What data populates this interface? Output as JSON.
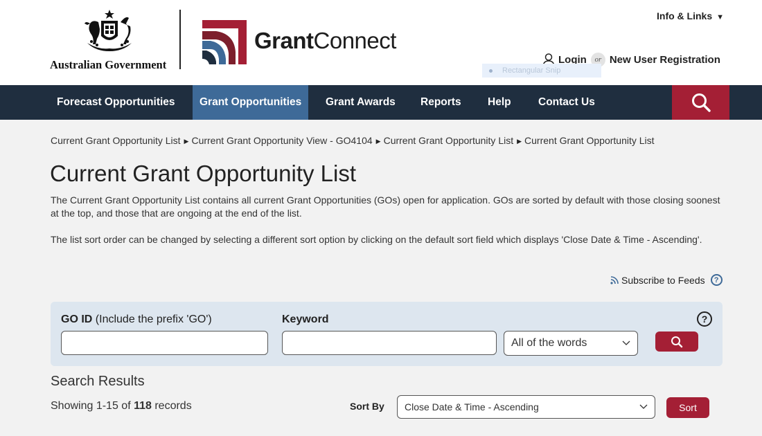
{
  "header": {
    "govt_logo_text": "Australian Government",
    "brand_bold": "Grant",
    "brand_light": "Connect",
    "info_links": "Info & Links",
    "login": "Login",
    "or": "or",
    "register": "New User Registration",
    "snip_overlay": "Rectangular Snip"
  },
  "nav": {
    "items": [
      {
        "label": "Forecast Opportunities"
      },
      {
        "label": "Grant Opportunities"
      },
      {
        "label": "Grant Awards"
      },
      {
        "label": "Reports"
      },
      {
        "label": "Help"
      },
      {
        "label": "Contact Us"
      }
    ],
    "active_index": 1
  },
  "breadcrumb": [
    "Current Grant Opportunity List",
    "Current Grant Opportunity View - GO4104",
    "Current Grant Opportunity List",
    "Current Grant Opportunity List"
  ],
  "page": {
    "title": "Current Grant Opportunity List",
    "intro": "The Current Grant Opportunity List contains all current Grant Opportunities (GOs) open for application. GOs are sorted by default with those closing soonest at the top, and those that are ongoing at the end of the list.",
    "intro2": "The list sort order can be changed by selecting a different sort option by clicking on the default sort field which displays 'Close Date & Time - Ascending'.",
    "subscribe": "Subscribe to Feeds"
  },
  "search": {
    "go_id_label": "GO ID",
    "go_id_hint": "(Include the prefix 'GO')",
    "go_id_value": "",
    "keyword_label": "Keyword",
    "keyword_value": "",
    "match_mode": "All of the words",
    "help": "?"
  },
  "results": {
    "title": "Search Results",
    "showing_prefix": "Showing 1-15 of ",
    "total": "118",
    "showing_suffix": " records",
    "sort_by_label": "Sort By",
    "sort_value": "Close Date & Time - Ascending",
    "sort_button": "Sort"
  },
  "colors": {
    "nav_bg": "#1f2e3f",
    "nav_active": "#3e6a98",
    "accent_red": "#a41f35",
    "panel_bg": "#dde6ef"
  }
}
